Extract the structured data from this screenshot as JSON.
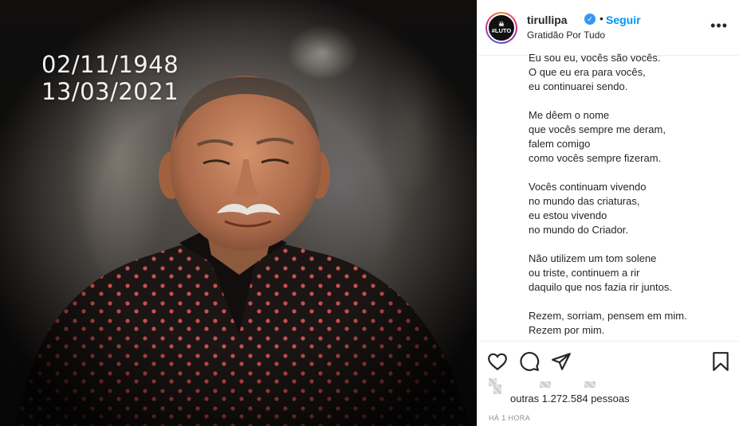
{
  "photo": {
    "birth_date": "02/11/1948",
    "death_date": "13/03/2021"
  },
  "header": {
    "avatar_text": "#LUTO",
    "username": "tirullipa",
    "separator": "•",
    "follow_label": "Seguir",
    "location": "Gratidão Por Tudo",
    "more_icon": "more-options-icon"
  },
  "caption": {
    "stanzas": [
      "Eu sou eu, vocês são vocês.\nO que eu era para vocês,\neu continuarei sendo.",
      "Me dêem o nome\nque vocês sempre me deram,\nfalem comigo\ncomo vocês sempre fizeram.",
      "Vocês continuam vivendo\nno mundo das criaturas,\neu estou vivendo\nno mundo do Criador.",
      "Não utilizem um tom solene\nou triste, continuem a rir\ndaquilo que nos fazia rir juntos.",
      "Rezem, sorriam, pensem em mim.\nRezem por mim."
    ]
  },
  "actions": {
    "like_icon": "heart-icon",
    "comment_icon": "comment-icon",
    "share_icon": "share-icon",
    "save_icon": "bookmark-icon",
    "likes_text": "outras 1.272.584 pessoas",
    "timestamp": "HÁ 1 HORA"
  },
  "colors": {
    "accent": "#0095f6",
    "verified": "#3897f0",
    "text": "#262626",
    "muted": "#8e8e8e",
    "border": "#efefef"
  }
}
